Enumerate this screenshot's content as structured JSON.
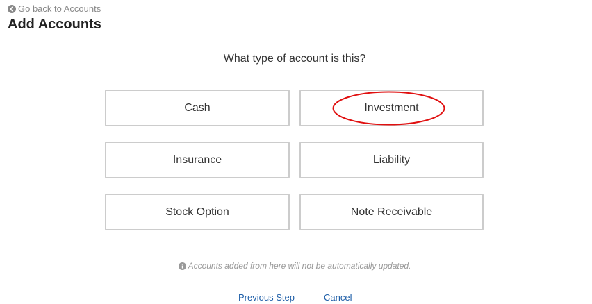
{
  "header": {
    "back_label": "Go back to Accounts",
    "title": "Add Accounts"
  },
  "question": "What type of account is this?",
  "account_types": [
    {
      "label": "Cash"
    },
    {
      "label": "Investment",
      "highlighted": true
    },
    {
      "label": "Insurance"
    },
    {
      "label": "Liability"
    },
    {
      "label": "Stock Option"
    },
    {
      "label": "Note Receivable"
    }
  ],
  "note": "Accounts added from here will not be automatically updated.",
  "footer": {
    "previous_label": "Previous Step",
    "cancel_label": "Cancel"
  },
  "colors": {
    "link": "#1f5fa8",
    "highlight_ring": "#e01010",
    "border": "#cccccc"
  }
}
